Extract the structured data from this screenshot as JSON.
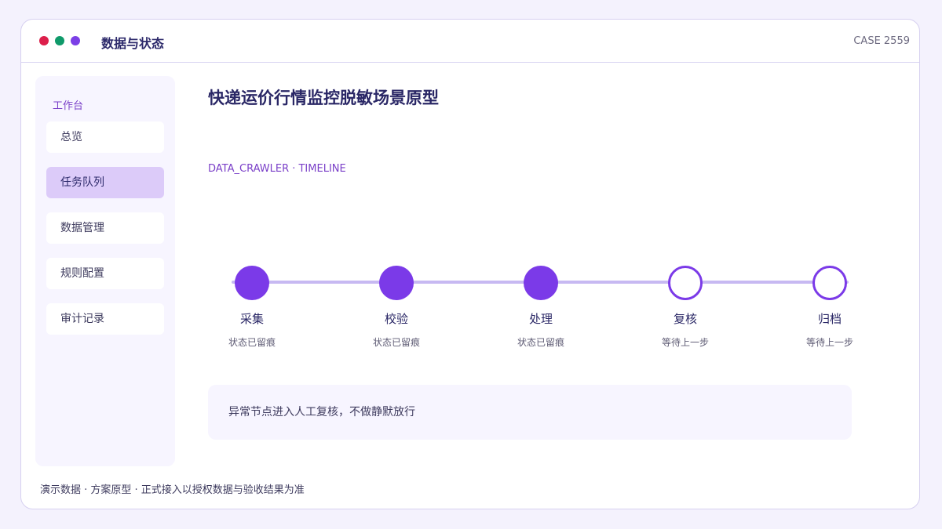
{
  "window": {
    "app_title": "数据与状态",
    "case_id": "CASE 2559",
    "controls": {
      "close_color": "#dc1f4b",
      "minimize_color": "#0f9a6a",
      "maximize_color": "#7b3fe6"
    }
  },
  "sidebar": {
    "heading": "工作台",
    "items": [
      {
        "label": "总览",
        "active": false
      },
      {
        "label": "任务队列",
        "active": true
      },
      {
        "label": "数据管理",
        "active": false
      },
      {
        "label": "规则配置",
        "active": false
      },
      {
        "label": "审计记录",
        "active": false
      }
    ]
  },
  "main": {
    "title": "快递运价行情监控脱敏场景原型",
    "breadcrumb": "DATA_CRAWLER · TIMELINE",
    "timeline": {
      "accent_color": "#7b3ae8",
      "steps": [
        {
          "label": "采集",
          "status": "状态已留痕",
          "state": "done"
        },
        {
          "label": "校验",
          "status": "状态已留痕",
          "state": "done"
        },
        {
          "label": "处理",
          "status": "状态已留痕",
          "state": "done"
        },
        {
          "label": "复核",
          "status": "等待上一步",
          "state": "pending"
        },
        {
          "label": "归档",
          "status": "等待上一步",
          "state": "pending"
        }
      ]
    },
    "notice": "异常节点进入人工复核，不做静默放行"
  },
  "footer": "演示数据 · 方案原型 · 正式接入以授权数据与验收结果为准"
}
